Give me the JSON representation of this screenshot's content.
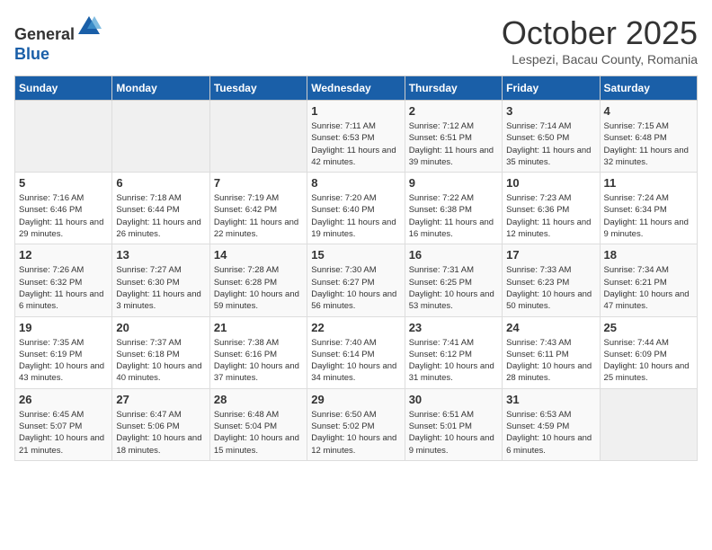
{
  "header": {
    "logo_line1": "General",
    "logo_line2": "Blue",
    "month": "October 2025",
    "location": "Lespezi, Bacau County, Romania"
  },
  "weekdays": [
    "Sunday",
    "Monday",
    "Tuesday",
    "Wednesday",
    "Thursday",
    "Friday",
    "Saturday"
  ],
  "weeks": [
    [
      {
        "day": "",
        "info": ""
      },
      {
        "day": "",
        "info": ""
      },
      {
        "day": "",
        "info": ""
      },
      {
        "day": "1",
        "info": "Sunrise: 7:11 AM\nSunset: 6:53 PM\nDaylight: 11 hours and 42 minutes."
      },
      {
        "day": "2",
        "info": "Sunrise: 7:12 AM\nSunset: 6:51 PM\nDaylight: 11 hours and 39 minutes."
      },
      {
        "day": "3",
        "info": "Sunrise: 7:14 AM\nSunset: 6:50 PM\nDaylight: 11 hours and 35 minutes."
      },
      {
        "day": "4",
        "info": "Sunrise: 7:15 AM\nSunset: 6:48 PM\nDaylight: 11 hours and 32 minutes."
      }
    ],
    [
      {
        "day": "5",
        "info": "Sunrise: 7:16 AM\nSunset: 6:46 PM\nDaylight: 11 hours and 29 minutes."
      },
      {
        "day": "6",
        "info": "Sunrise: 7:18 AM\nSunset: 6:44 PM\nDaylight: 11 hours and 26 minutes."
      },
      {
        "day": "7",
        "info": "Sunrise: 7:19 AM\nSunset: 6:42 PM\nDaylight: 11 hours and 22 minutes."
      },
      {
        "day": "8",
        "info": "Sunrise: 7:20 AM\nSunset: 6:40 PM\nDaylight: 11 hours and 19 minutes."
      },
      {
        "day": "9",
        "info": "Sunrise: 7:22 AM\nSunset: 6:38 PM\nDaylight: 11 hours and 16 minutes."
      },
      {
        "day": "10",
        "info": "Sunrise: 7:23 AM\nSunset: 6:36 PM\nDaylight: 11 hours and 12 minutes."
      },
      {
        "day": "11",
        "info": "Sunrise: 7:24 AM\nSunset: 6:34 PM\nDaylight: 11 hours and 9 minutes."
      }
    ],
    [
      {
        "day": "12",
        "info": "Sunrise: 7:26 AM\nSunset: 6:32 PM\nDaylight: 11 hours and 6 minutes."
      },
      {
        "day": "13",
        "info": "Sunrise: 7:27 AM\nSunset: 6:30 PM\nDaylight: 11 hours and 3 minutes."
      },
      {
        "day": "14",
        "info": "Sunrise: 7:28 AM\nSunset: 6:28 PM\nDaylight: 10 hours and 59 minutes."
      },
      {
        "day": "15",
        "info": "Sunrise: 7:30 AM\nSunset: 6:27 PM\nDaylight: 10 hours and 56 minutes."
      },
      {
        "day": "16",
        "info": "Sunrise: 7:31 AM\nSunset: 6:25 PM\nDaylight: 10 hours and 53 minutes."
      },
      {
        "day": "17",
        "info": "Sunrise: 7:33 AM\nSunset: 6:23 PM\nDaylight: 10 hours and 50 minutes."
      },
      {
        "day": "18",
        "info": "Sunrise: 7:34 AM\nSunset: 6:21 PM\nDaylight: 10 hours and 47 minutes."
      }
    ],
    [
      {
        "day": "19",
        "info": "Sunrise: 7:35 AM\nSunset: 6:19 PM\nDaylight: 10 hours and 43 minutes."
      },
      {
        "day": "20",
        "info": "Sunrise: 7:37 AM\nSunset: 6:18 PM\nDaylight: 10 hours and 40 minutes."
      },
      {
        "day": "21",
        "info": "Sunrise: 7:38 AM\nSunset: 6:16 PM\nDaylight: 10 hours and 37 minutes."
      },
      {
        "day": "22",
        "info": "Sunrise: 7:40 AM\nSunset: 6:14 PM\nDaylight: 10 hours and 34 minutes."
      },
      {
        "day": "23",
        "info": "Sunrise: 7:41 AM\nSunset: 6:12 PM\nDaylight: 10 hours and 31 minutes."
      },
      {
        "day": "24",
        "info": "Sunrise: 7:43 AM\nSunset: 6:11 PM\nDaylight: 10 hours and 28 minutes."
      },
      {
        "day": "25",
        "info": "Sunrise: 7:44 AM\nSunset: 6:09 PM\nDaylight: 10 hours and 25 minutes."
      }
    ],
    [
      {
        "day": "26",
        "info": "Sunrise: 6:45 AM\nSunset: 5:07 PM\nDaylight: 10 hours and 21 minutes."
      },
      {
        "day": "27",
        "info": "Sunrise: 6:47 AM\nSunset: 5:06 PM\nDaylight: 10 hours and 18 minutes."
      },
      {
        "day": "28",
        "info": "Sunrise: 6:48 AM\nSunset: 5:04 PM\nDaylight: 10 hours and 15 minutes."
      },
      {
        "day": "29",
        "info": "Sunrise: 6:50 AM\nSunset: 5:02 PM\nDaylight: 10 hours and 12 minutes."
      },
      {
        "day": "30",
        "info": "Sunrise: 6:51 AM\nSunset: 5:01 PM\nDaylight: 10 hours and 9 minutes."
      },
      {
        "day": "31",
        "info": "Sunrise: 6:53 AM\nSunset: 4:59 PM\nDaylight: 10 hours and 6 minutes."
      },
      {
        "day": "",
        "info": ""
      }
    ]
  ]
}
